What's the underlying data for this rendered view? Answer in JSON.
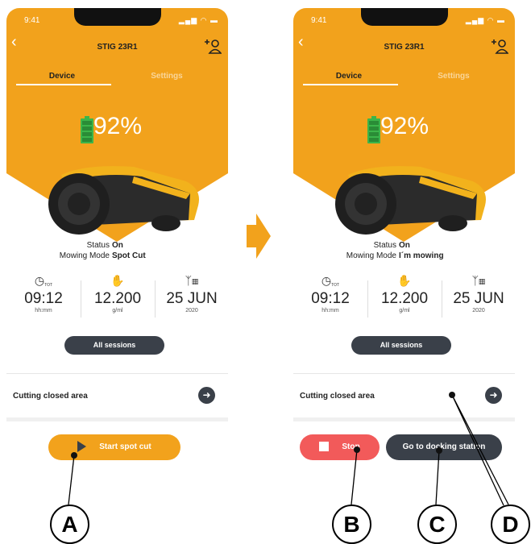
{
  "status_bar": {
    "time": "9:41",
    "icons": "..ıl ᯤ ▬"
  },
  "header": {
    "title": "STIG 23R1",
    "back": "‹"
  },
  "tabs": [
    "Device",
    "Settings"
  ],
  "battery_percent": "92%",
  "colors": {
    "accent": "#F2A21C",
    "dark": "#3A4049",
    "stop": "#F25A5A",
    "battery": "#3CB54A"
  },
  "status": {
    "label": "Status",
    "value": "On"
  },
  "mowing_label": "Mowing Mode",
  "left_screen": {
    "mowing_value": "Spot Cut",
    "button_label": "Start spot cut"
  },
  "right_screen": {
    "mowing_value": "I´m mowing",
    "stop_label": "Stop",
    "dock_label": "Go to docking station"
  },
  "stats": [
    {
      "icon": "clock-tot-icon",
      "icon_text": "TOT",
      "value": "09:12",
      "unit": "hh:mm"
    },
    {
      "icon": "hand-drop-icon",
      "value": "12.200",
      "unit": "g/ml"
    },
    {
      "icon": "grass-calendar-icon",
      "value": "25 JUN",
      "unit": "2020"
    }
  ],
  "sessions_label": "All sessions",
  "cutting_area_label": "Cutting closed area",
  "callouts": [
    "A",
    "B",
    "C",
    "D"
  ]
}
